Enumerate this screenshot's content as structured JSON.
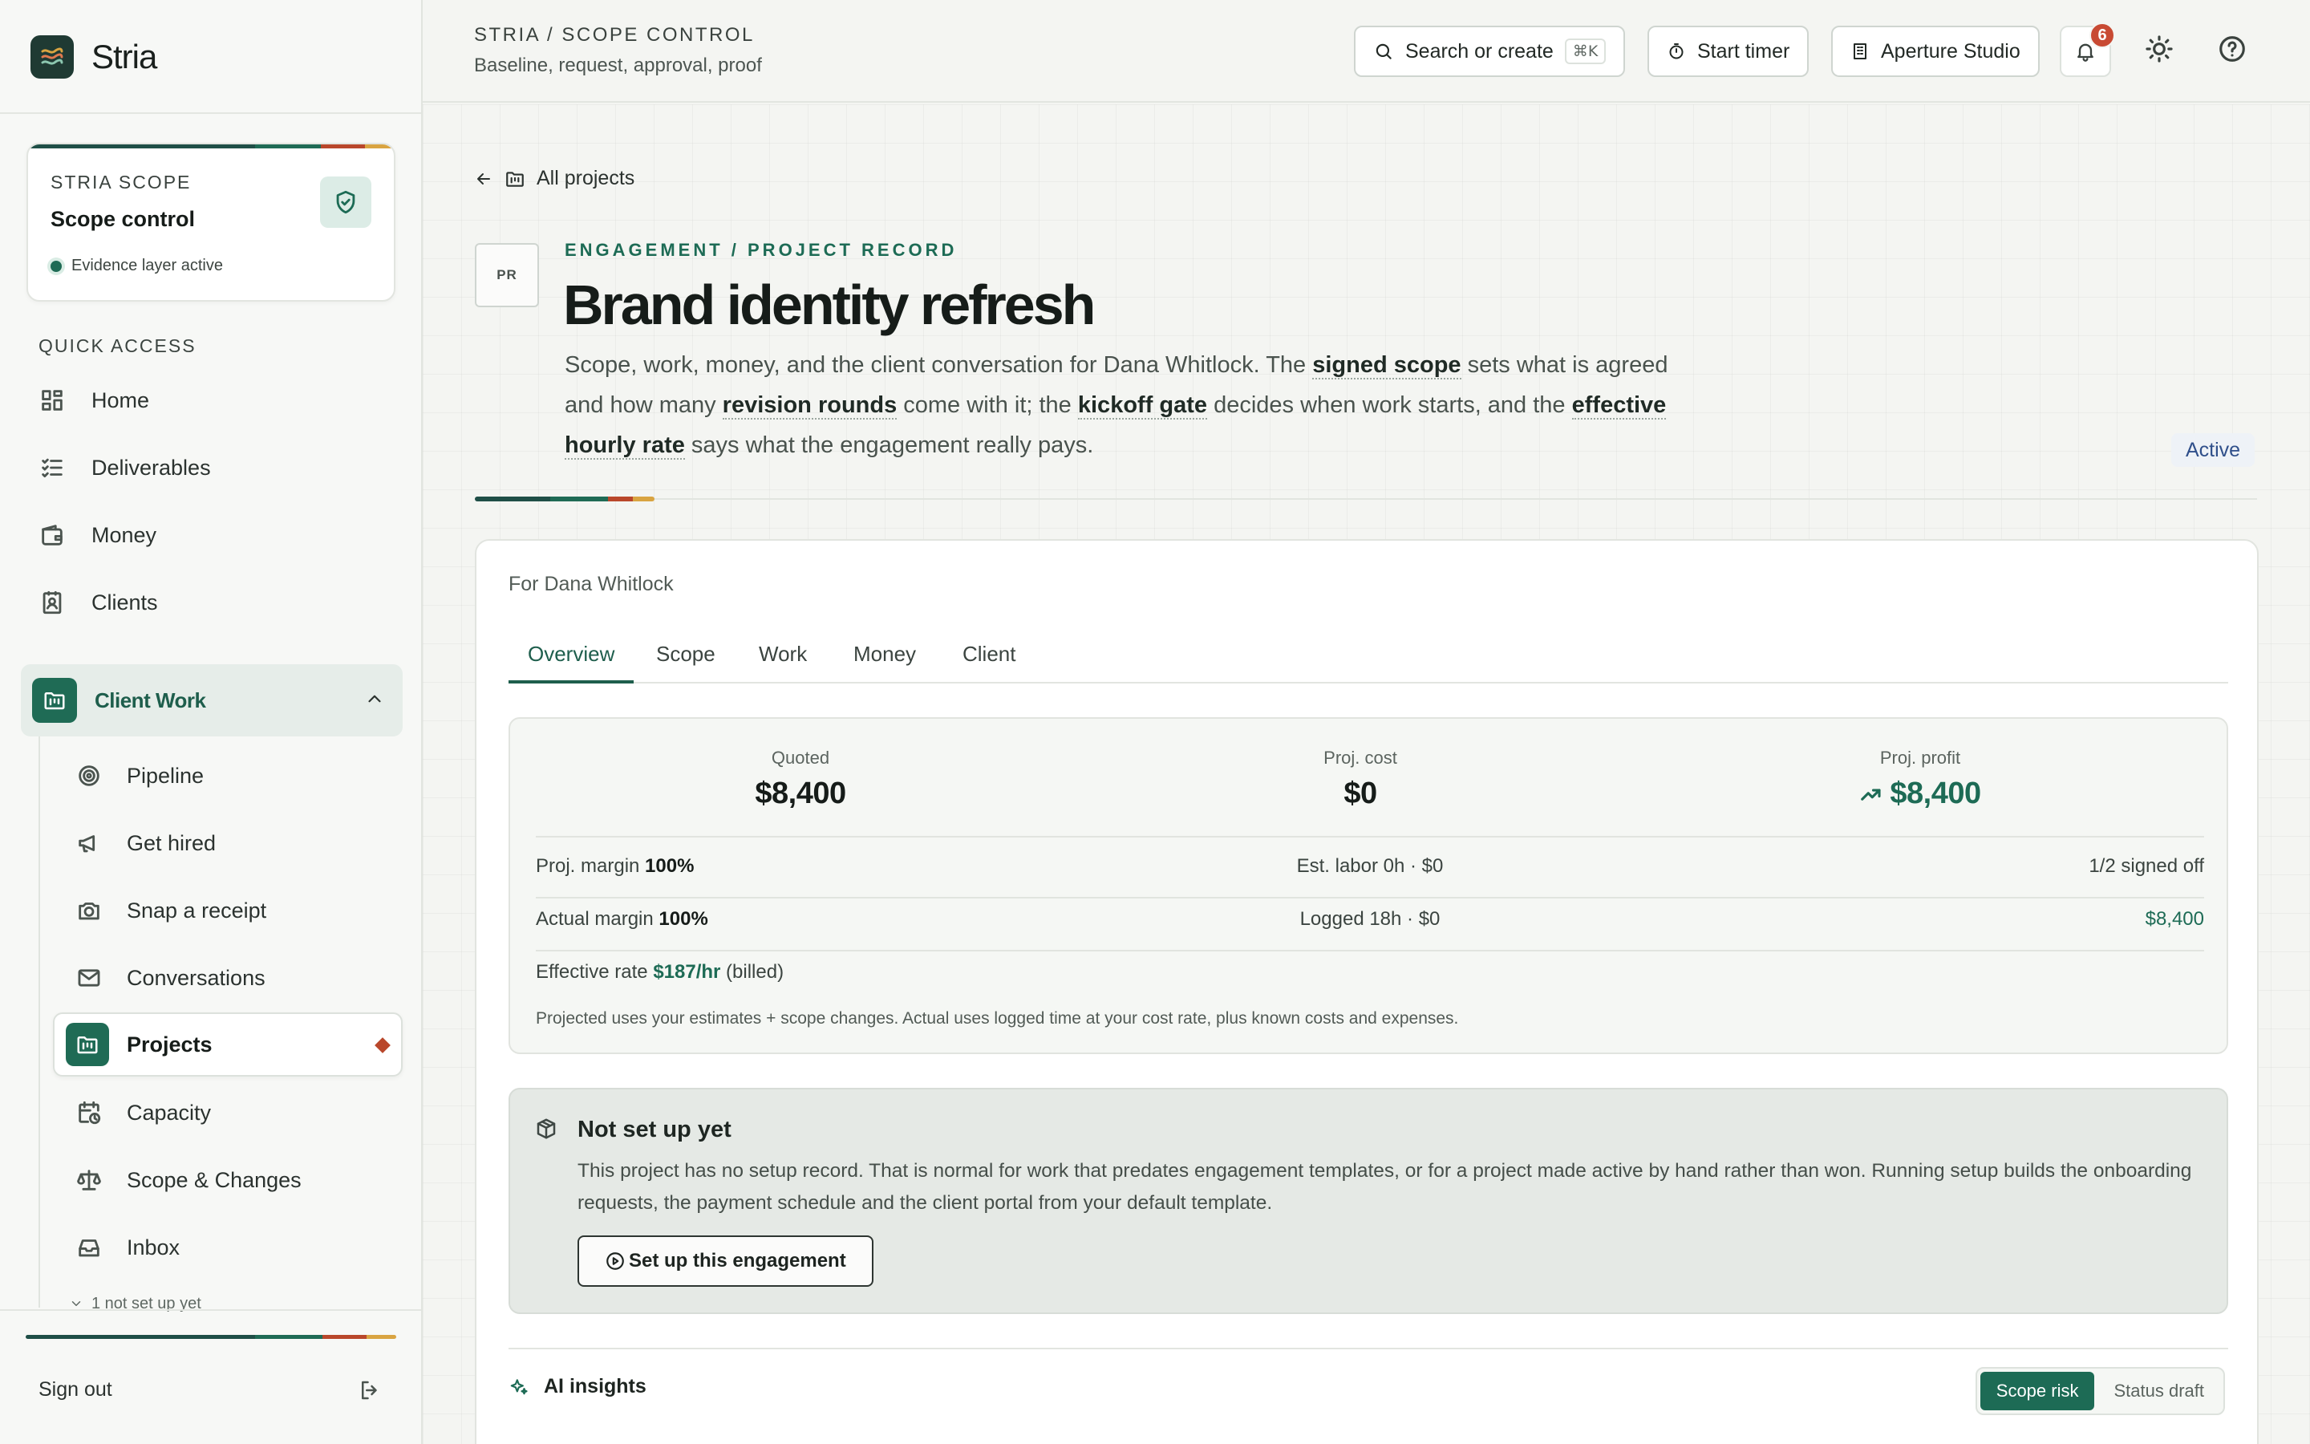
{
  "brand": {
    "name": "Stria"
  },
  "sidebar": {
    "scope_card": {
      "eyebrow": "STRIA SCOPE",
      "title": "Scope control",
      "status": "Evidence layer active"
    },
    "quick_access_heading": "QUICK ACCESS",
    "quick_access": [
      {
        "label": "Home",
        "icon": "grid-icon"
      },
      {
        "label": "Deliverables",
        "icon": "checklist-icon"
      },
      {
        "label": "Money",
        "icon": "wallet-icon"
      },
      {
        "label": "Clients",
        "icon": "contact-icon"
      }
    ],
    "client_work": {
      "label": "Client Work",
      "items": [
        {
          "label": "Pipeline",
          "icon": "target-icon"
        },
        {
          "label": "Get hired",
          "icon": "megaphone-icon"
        },
        {
          "label": "Snap a receipt",
          "icon": "camera-icon"
        },
        {
          "label": "Conversations",
          "icon": "mail-icon"
        },
        {
          "label": "Projects",
          "icon": "folder-kanban-icon",
          "active": true
        },
        {
          "label": "Capacity",
          "icon": "calendar-clock-icon"
        },
        {
          "label": "Scope & Changes",
          "icon": "scale-icon"
        },
        {
          "label": "Inbox",
          "icon": "inbox-icon"
        }
      ],
      "hint": "1 not set up yet"
    },
    "sign_out": "Sign out"
  },
  "topbar": {
    "breadcrumb": "STRIA / SCOPE CONTROL",
    "subtitle": "Baseline, request, approval, proof",
    "search": {
      "label": "Search or create",
      "shortcut": "⌘K"
    },
    "timer_label": "Start timer",
    "workspace_label": "Aperture Studio",
    "notifications_count": "6"
  },
  "project": {
    "back_label": "All projects",
    "badge": "PR",
    "eyebrow": "ENGAGEMENT / PROJECT RECORD",
    "title": "Brand identity refresh",
    "description": {
      "p1": "Scope, work, money, and the client conversation for Dana Whitlock. The ",
      "t1": "signed scope",
      "p2": " sets what is agreed and how many ",
      "t2": "revision rounds",
      "p3": " come with it; the ",
      "t3": "kickoff gate",
      "p4": " decides when work starts, and the ",
      "t4": "effective hourly rate",
      "p5": " says what the engagement really pays."
    },
    "status": "Active"
  },
  "panel": {
    "for_label": "For Dana Whitlock",
    "tabs": [
      "Overview",
      "Scope",
      "Work",
      "Money",
      "Client"
    ],
    "active_tab": "Overview",
    "metrics": {
      "quoted": {
        "label": "Quoted",
        "value": "$8,400"
      },
      "cost": {
        "label": "Proj. cost",
        "value": "$0"
      },
      "profit": {
        "label": "Proj. profit",
        "value": "$8,400"
      }
    },
    "row1": {
      "left_label": "Proj. margin",
      "left_value": "100%",
      "center": "Est. labor 0h · $0",
      "right": "1/2 signed off"
    },
    "row2": {
      "left_label": "Actual margin",
      "left_value": "100%",
      "center": "Logged 18h · $0",
      "right": "$8,400"
    },
    "rate": {
      "label": "Effective rate",
      "value": "$187/hr",
      "suffix": "(billed)"
    },
    "note": "Projected uses your estimates + scope changes. Actual uses logged time at your cost rate, plus known costs and expenses.",
    "setup": {
      "title": "Not set up yet",
      "body": "This project has no setup record. That is normal for work that predates engagement templates, or for a project made active by hand rather than won. Running setup builds the onboarding requests, the payment schedule and the client portal from your default template.",
      "button": "Set up this engagement"
    },
    "insights": {
      "title": "AI insights",
      "toggle": [
        "Scope risk",
        "Status draft"
      ],
      "active": "Scope risk"
    }
  },
  "colors": {
    "accent": "#1d6b55",
    "stripe": [
      "#1f4f47",
      "#1f6b55",
      "#b9472b",
      "#d9a441"
    ],
    "badge": "#c84a33"
  }
}
